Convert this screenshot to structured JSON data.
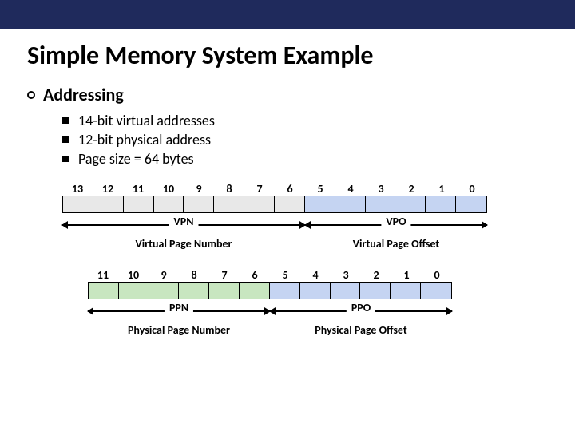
{
  "title": "Simple Memory System Example",
  "section": "Addressing",
  "bullets": [
    "14-bit virtual addresses",
    "12-bit physical address",
    "Page size = 64 bytes"
  ],
  "virtual": {
    "bits": [
      "13",
      "12",
      "11",
      "10",
      "9",
      "8",
      "7",
      "6",
      "5",
      "4",
      "3",
      "2",
      "1",
      "0"
    ],
    "vpn_label": "VPN",
    "vpo_label": "VPO",
    "vpn_full": "Virtual Page Number",
    "vpo_full": "Virtual Page Offset"
  },
  "physical": {
    "bits": [
      "11",
      "10",
      "9",
      "8",
      "7",
      "6",
      "5",
      "4",
      "3",
      "2",
      "1",
      "0"
    ],
    "ppn_label": "PPN",
    "ppo_label": "PPO",
    "ppn_full": "Physical Page Number",
    "ppo_full": "Physical Page Offset"
  }
}
